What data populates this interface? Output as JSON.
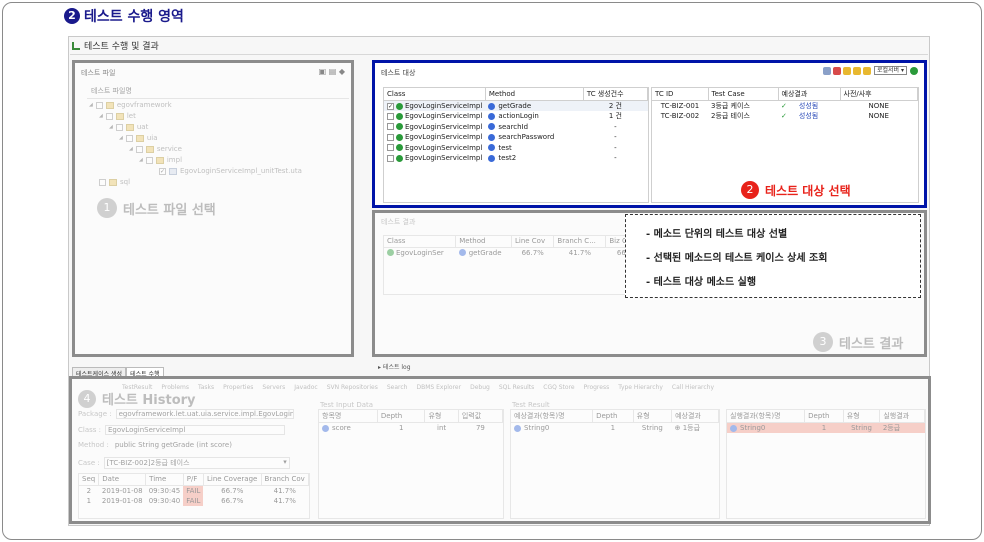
{
  "heading": {
    "number": "2",
    "title": "테스트 수행 영역"
  },
  "app_title": "테스트 수행 및 결과",
  "test_file_pane": {
    "title": "테스트 파일",
    "tree_header": "테스트 파일명",
    "tree": [
      {
        "label": "egovframework",
        "checked": false
      },
      {
        "label": "let",
        "checked": false
      },
      {
        "label": "uat",
        "checked": false
      },
      {
        "label": "uia",
        "checked": false
      },
      {
        "label": "service",
        "checked": false
      },
      {
        "label": "impl",
        "checked": false
      },
      {
        "label": "EgovLoginServiceImpl_unitTest.uta",
        "checked": true
      },
      {
        "label": "sql",
        "checked": false
      }
    ],
    "step_number": "1",
    "step_label": "테스트 파일 선택"
  },
  "test_target_pane": {
    "title": "테스트 대상",
    "dropdown": "로컬서버",
    "left_columns": [
      "Class",
      "Method",
      "TC 생성건수"
    ],
    "left_rows": [
      {
        "class": "EgovLoginServiceImpl",
        "method": "getGrade",
        "count": "2 건",
        "checked": true
      },
      {
        "class": "EgovLoginServiceImpl",
        "method": "actionLogin",
        "count": "1 건",
        "checked": false
      },
      {
        "class": "EgovLoginServiceImpl",
        "method": "searchId",
        "count": "-",
        "checked": false
      },
      {
        "class": "EgovLoginServiceImpl",
        "method": "searchPassword",
        "count": "-",
        "checked": false
      },
      {
        "class": "EgovLoginServiceImpl",
        "method": "test",
        "count": "-",
        "checked": false
      },
      {
        "class": "EgovLoginServiceImpl",
        "method": "test2",
        "count": "-",
        "checked": false
      }
    ],
    "right_columns": [
      "TC ID",
      "Test Case",
      "예상결과",
      "사전/사후"
    ],
    "right_rows": [
      {
        "id": "TC-BIZ-001",
        "case": "3등급 케이스",
        "check": "✓",
        "expected": "성성됨",
        "prepost": "NONE"
      },
      {
        "id": "TC-BIZ-002",
        "case": "2등급 테이스",
        "check": "✓",
        "expected": "성성됨",
        "prepost": "NONE"
      }
    ],
    "step_number": "2",
    "step_label": "테스트 대상 선택"
  },
  "test_result_pane": {
    "title": "테스트 결과",
    "columns": [
      "Class",
      "Method",
      "Line Cov",
      "Branch C...",
      "Biz Cov"
    ],
    "row": {
      "class": "EgovLoginSer",
      "method": "getGrade",
      "line": "66.7%",
      "branch": "41.7%",
      "biz": "66.7"
    },
    "step_number": "3",
    "step_label": "테스트 결과"
  },
  "callout": [
    "- 메소드 단위의 테스트 대상 선별",
    "- 선택된 메소드의 테스트 케이스 상세 조회",
    "- 테스트 대상 메소드 실행"
  ],
  "bottom_tabs": [
    "테스트케이스 생성",
    "테스트 수행"
  ],
  "log_label": "테스트 log",
  "history": {
    "step_number": "4",
    "step_label": "테스트 History",
    "view_tabs": [
      "TestResult",
      "Problems",
      "Tasks",
      "Properties",
      "Servers",
      "Javadoc",
      "SVN Repositories",
      "Search",
      "DBMS Explorer",
      "Debug",
      "SQL Results",
      "CGQ Store",
      "Progress",
      "Type Hierarchy",
      "Call Hierarchy"
    ],
    "package_label": "Package :",
    "package_value": "egovframework.let.uat.uia.service.impl.EgovLoginServiceImpl",
    "class_label": "Class :",
    "class_value": "EgovLoginServiceImpl",
    "method_label": "Method :",
    "method_value": "public String getGrade (int score)",
    "case_label": "Case :",
    "case_value": "[TC-BIZ-002]2등급 테이스",
    "seq_columns": [
      "Seq",
      "Date",
      "Time",
      "P/F",
      "Line Coverage",
      "Branch Cov"
    ],
    "seq_rows": [
      {
        "seq": "2",
        "date": "2019-01-08",
        "time": "09:30:45",
        "pf": "FAIL",
        "line": "66.7%",
        "branch": "41.7%"
      },
      {
        "seq": "1",
        "date": "2019-01-08",
        "time": "09:30:40",
        "pf": "FAIL",
        "line": "66.7%",
        "branch": "41.7%"
      }
    ],
    "input_title": "Test Input Data",
    "input_columns": [
      "항목명",
      "Depth",
      "유형",
      "입력값"
    ],
    "input_row": {
      "name": "score",
      "depth": "1",
      "type": "int",
      "value": "79"
    },
    "result_title": "Test Result",
    "result_columns": [
      "예상결과(항목)명",
      "Depth",
      "유형",
      "예상결과"
    ],
    "result_row": {
      "name": "String0",
      "depth": "1",
      "type": "String",
      "value": "1등급"
    },
    "actual_columns": [
      "실행결과(항목)명",
      "Depth",
      "유형",
      "실행결과"
    ],
    "actual_row": {
      "name": "String0",
      "depth": "1",
      "type": "String",
      "value": "2등급"
    }
  }
}
